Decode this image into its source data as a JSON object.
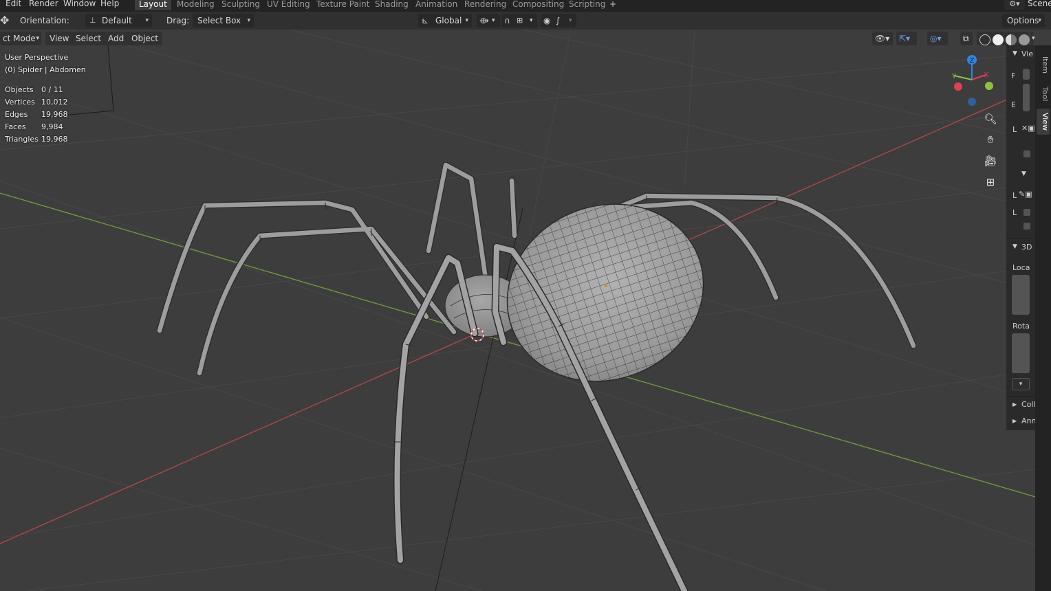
{
  "menu": {
    "items": [
      "Edit",
      "Render",
      "Window",
      "Help"
    ]
  },
  "workspaces": {
    "tabs": [
      "Layout",
      "Modeling",
      "Sculpting",
      "UV Editing",
      "Texture Paint",
      "Shading",
      "Animation",
      "Rendering",
      "Compositing",
      "Scripting"
    ],
    "active": "Layout",
    "add_symbol": "+",
    "scene_label": "Scene"
  },
  "tool_header": {
    "orientation_label": "Orientation:",
    "orientation_value": "Default",
    "drag_label": "Drag:",
    "drag_value": "Select Box",
    "transform_orientation": "Global",
    "options_label": "Options"
  },
  "viewport_header": {
    "mode": "ct Mode",
    "view": "View",
    "select": "Select",
    "add": "Add",
    "object": "Object"
  },
  "overlay": {
    "perspective": "User Perspective",
    "context": "(0) Spider | Abdomen",
    "stats": [
      {
        "label": "Objects",
        "value": "0 / 11"
      },
      {
        "label": "Vertices",
        "value": "10,012"
      },
      {
        "label": "Edges",
        "value": "19,968"
      },
      {
        "label": "Faces",
        "value": "9,984"
      },
      {
        "label": "Triangles",
        "value": "19,968"
      }
    ]
  },
  "gizmo": {
    "z": "Z",
    "y": "Y",
    "x": "X",
    "colors": {
      "x": "#e0404f",
      "y": "#8bc43c",
      "z": "#2e86de"
    }
  },
  "nav_icons": [
    "zoom-icon",
    "hand-pan-icon",
    "camera-icon",
    "grid-icon"
  ],
  "sidebar": {
    "section_view": "Vie",
    "letter_f": "F",
    "letter_e": "E",
    "letter_l1": "L",
    "letter_l2": "L",
    "letter_l3": "L",
    "section_3d": "3D",
    "location": "Loca",
    "rotation": "Rota",
    "collections": "Coll",
    "annotations": "Ann",
    "tabs": [
      "Item",
      "Tool",
      "View"
    ],
    "active_tab": "View"
  },
  "colors": {
    "x_axis": "#b04646",
    "y_axis": "#6e9a3a",
    "grid": "#474747",
    "mesh": "#9b9b9b",
    "wire": "#2a2a2a"
  }
}
